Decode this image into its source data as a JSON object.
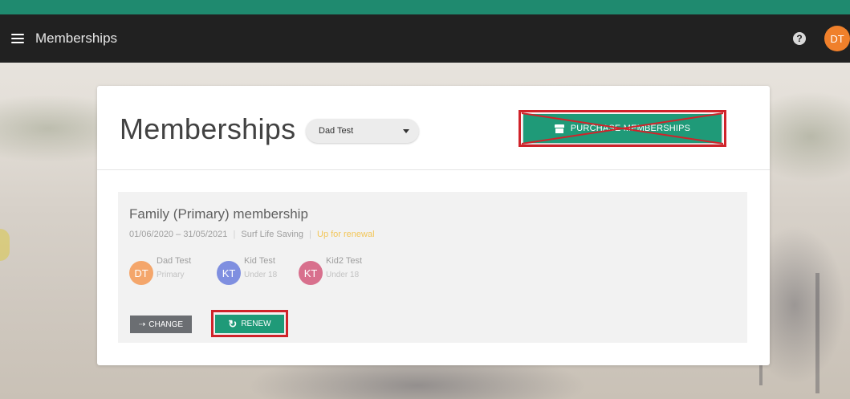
{
  "appbar": {
    "title": "Memberships",
    "user_initials": "DT",
    "help_symbol": "?"
  },
  "page": {
    "title": "Memberships",
    "person_select": {
      "value": "Dad Test"
    },
    "purchase_button": {
      "label": "PURCHASE MEMBERSHIPS",
      "icon": "shop-icon",
      "annotation": "crossed out"
    }
  },
  "membership": {
    "name": "Family (Primary) membership",
    "start_date": "01/06/2020",
    "date_separator": "–",
    "end_date": "31/05/2021",
    "organisation": "Surf Life Saving",
    "status": "Up for renewal",
    "members": [
      {
        "initials": "DT",
        "name": "Dad Test",
        "role": "Primary",
        "color": "#f4a66b"
      },
      {
        "initials": "KT",
        "name": "Kid Test",
        "role": "Under 18",
        "color": "#7f8fe0"
      },
      {
        "initials": "KT",
        "name": "Kid2 Test",
        "role": "Under 18",
        "color": "#d8708d"
      }
    ],
    "change_button": {
      "label": "CHANGE",
      "icon": "change-icon"
    },
    "renew_button": {
      "label": "RENEW",
      "icon": "refresh-icon"
    }
  },
  "colors": {
    "accent": "#1f9a78",
    "appbar": "#212121",
    "annotation_red": "#d0232a",
    "renewal": "#f3c659"
  }
}
